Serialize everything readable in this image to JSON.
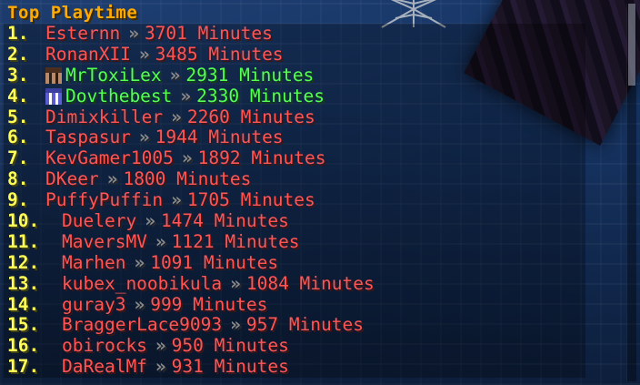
{
  "title": "Top Playtime",
  "separator": "»",
  "colors": {
    "title": "#ffaa00",
    "rank": "#ffff55",
    "entry_default": "#ff5555",
    "entry_highlight": "#55ff55",
    "separator": "#8a8a8a"
  },
  "entries": [
    {
      "rank": "1.",
      "name": "Esternn",
      "value": "3701 Minutes",
      "color": "red"
    },
    {
      "rank": "2.",
      "name": "RonanXII",
      "value": "3485 Minutes",
      "color": "red"
    },
    {
      "rank": "3.",
      "name": "MrToxiLex",
      "value": "2931 Minutes",
      "color": "green",
      "head_icon": "player-head-icon"
    },
    {
      "rank": "4.",
      "name": "Dovthebest",
      "value": "2330 Minutes",
      "color": "green",
      "head_icon": "player-head-icon"
    },
    {
      "rank": "5.",
      "name": "Dimixkiller",
      "value": "2260 Minutes",
      "color": "red"
    },
    {
      "rank": "6.",
      "name": "Taspasur",
      "value": "1944 Minutes",
      "color": "red"
    },
    {
      "rank": "7.",
      "name": "KevGamer1005",
      "value": "1892 Minutes",
      "color": "red"
    },
    {
      "rank": "8.",
      "name": "DKeer",
      "value": "1800 Minutes",
      "color": "red"
    },
    {
      "rank": "9.",
      "name": "PuffyPuffin",
      "value": "1705 Minutes",
      "color": "red"
    },
    {
      "rank": "10.",
      "name": "Duelery",
      "value": "1474 Minutes",
      "color": "red"
    },
    {
      "rank": "11.",
      "name": "MaversMV",
      "value": "1121 Minutes",
      "color": "red"
    },
    {
      "rank": "12.",
      "name": "Marhen",
      "value": "1091 Minutes",
      "color": "red"
    },
    {
      "rank": "13.",
      "name": "kubex_noobikula",
      "value": "1084 Minutes",
      "color": "red"
    },
    {
      "rank": "14.",
      "name": "guray3",
      "value": "999 Minutes",
      "color": "red"
    },
    {
      "rank": "15.",
      "name": "BraggerLace9093",
      "value": "957 Minutes",
      "color": "red"
    },
    {
      "rank": "16.",
      "name": "obirocks",
      "value": "950 Minutes",
      "color": "red"
    },
    {
      "rank": "17.",
      "name": "DaRealMf",
      "value": "931 Minutes",
      "color": "red"
    }
  ]
}
